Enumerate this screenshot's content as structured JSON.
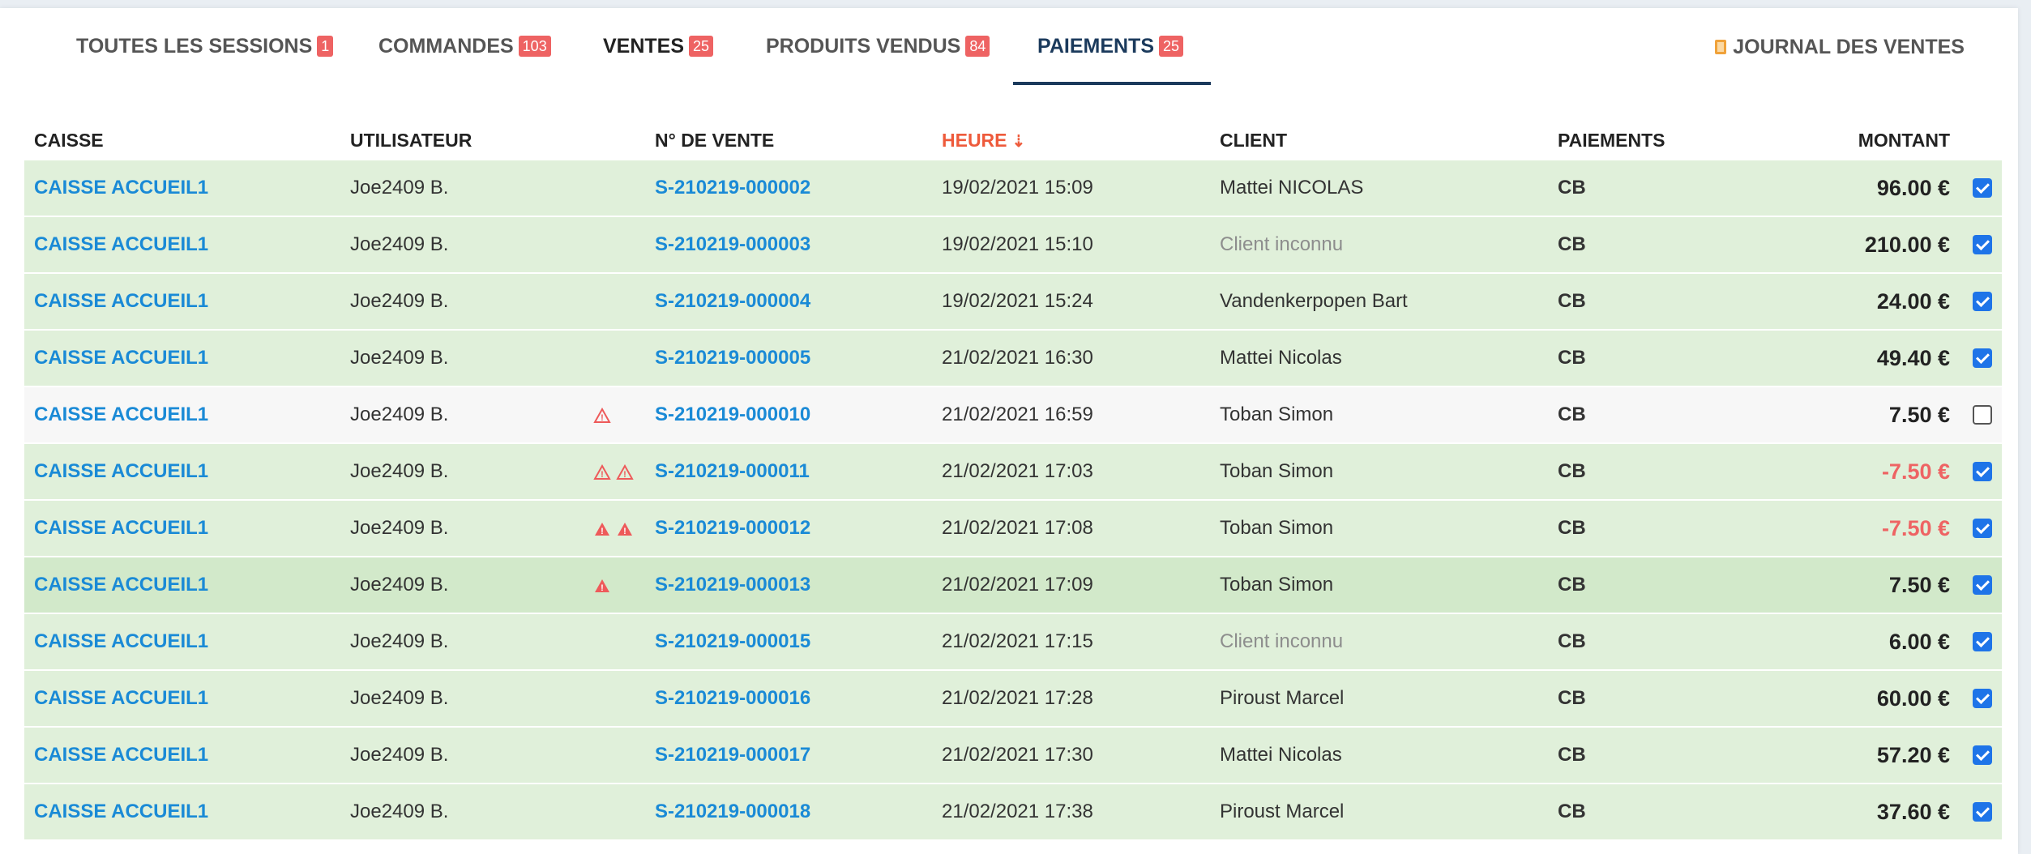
{
  "tabs": [
    {
      "label": "TOUTES LES SESSIONS",
      "count": "1"
    },
    {
      "label": "COMMANDES",
      "count": "103"
    },
    {
      "label": "VENTES",
      "count": "25"
    },
    {
      "label": "PRODUITS VENDUS",
      "count": "84"
    },
    {
      "label": "PAIEMENTS",
      "count": "25"
    }
  ],
  "journal_label": "JOURNAL DES VENTES",
  "columns": {
    "caisse": "CAISSE",
    "utilisateur": "UTILISATEUR",
    "vente": "N° DE VENTE",
    "heure": "HEURE",
    "client": "CLIENT",
    "paiements": "PAIEMENTS",
    "montant": "MONTANT"
  },
  "colors": {
    "accent": "#1a8ad6",
    "badge": "#ee6363",
    "sorted": "#ee5a3b",
    "row_green": "#e0f0da",
    "checkbox": "#1e74e8"
  },
  "rows": [
    {
      "caisse": "CAISSE ACCUEIL1",
      "user": "Joe2409 B.",
      "vente": "S-210219-000002",
      "heure": "19/02/2021 15:09",
      "client": "Mattei NICOLAS",
      "pay": "CB",
      "amount": "96.00 €"
    },
    {
      "caisse": "CAISSE ACCUEIL1",
      "user": "Joe2409 B.",
      "vente": "S-210219-000003",
      "heure": "19/02/2021 15:10",
      "client": "Client inconnu",
      "pay": "CB",
      "amount": "210.00 €"
    },
    {
      "caisse": "CAISSE ACCUEIL1",
      "user": "Joe2409 B.",
      "vente": "S-210219-000004",
      "heure": "19/02/2021 15:24",
      "client": "Vandenkerpopen Bart",
      "pay": "CB",
      "amount": "24.00 €"
    },
    {
      "caisse": "CAISSE ACCUEIL1",
      "user": "Joe2409 B.",
      "vente": "S-210219-000005",
      "heure": "21/02/2021 16:30",
      "client": "Mattei Nicolas",
      "pay": "CB",
      "amount": "49.40 €"
    },
    {
      "caisse": "CAISSE ACCUEIL1",
      "user": "Joe2409 B.",
      "vente": "S-210219-000010",
      "heure": "21/02/2021 16:59",
      "client": "Toban Simon",
      "pay": "CB",
      "amount": "7.50 €"
    },
    {
      "caisse": "CAISSE ACCUEIL1",
      "user": "Joe2409 B.",
      "vente": "S-210219-000011",
      "heure": "21/02/2021 17:03",
      "client": "Toban Simon",
      "pay": "CB",
      "amount": "-7.50 €"
    },
    {
      "caisse": "CAISSE ACCUEIL1",
      "user": "Joe2409 B.",
      "vente": "S-210219-000012",
      "heure": "21/02/2021 17:08",
      "client": "Toban Simon",
      "pay": "CB",
      "amount": "-7.50 €"
    },
    {
      "caisse": "CAISSE ACCUEIL1",
      "user": "Joe2409 B.",
      "vente": "S-210219-000013",
      "heure": "21/02/2021 17:09",
      "client": "Toban Simon",
      "pay": "CB",
      "amount": "7.50 €"
    },
    {
      "caisse": "CAISSE ACCUEIL1",
      "user": "Joe2409 B.",
      "vente": "S-210219-000015",
      "heure": "21/02/2021 17:15",
      "client": "Client inconnu",
      "pay": "CB",
      "amount": "6.00 €"
    },
    {
      "caisse": "CAISSE ACCUEIL1",
      "user": "Joe2409 B.",
      "vente": "S-210219-000016",
      "heure": "21/02/2021 17:28",
      "client": "Piroust Marcel",
      "pay": "CB",
      "amount": "60.00 €"
    },
    {
      "caisse": "CAISSE ACCUEIL1",
      "user": "Joe2409 B.",
      "vente": "S-210219-000017",
      "heure": "21/02/2021 17:30",
      "client": "Mattei Nicolas",
      "pay": "CB",
      "amount": "57.20 €"
    },
    {
      "caisse": "CAISSE ACCUEIL1",
      "user": "Joe2409 B.",
      "vente": "S-210219-000018",
      "heure": "21/02/2021 17:38",
      "client": "Piroust Marcel",
      "pay": "CB",
      "amount": "37.60 €"
    }
  ]
}
